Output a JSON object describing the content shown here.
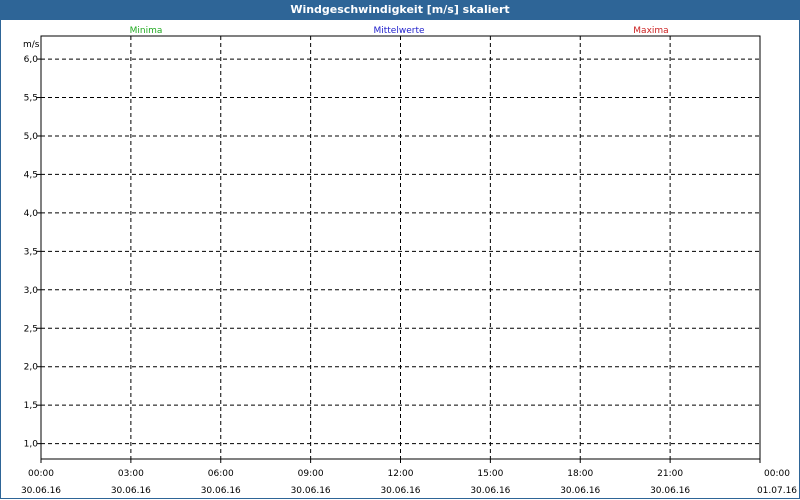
{
  "window": {
    "title": "Windgeschwindigkeit [m/s] skaliert"
  },
  "colors": {
    "titlebar": "#2e6597",
    "minima": "#22aa22",
    "mittelwerte": "#2222cc",
    "maxima": "#cc2222"
  },
  "chart_data": {
    "type": "line",
    "title": "Windgeschwindigkeit [m/s] skaliert",
    "ylabel": "m/s",
    "xlabel": "",
    "ylim": [
      0.8,
      6.3
    ],
    "yticks": [
      "6,0",
      "5,5",
      "5,0",
      "4,5",
      "4,0",
      "3,5",
      "3,0",
      "2,5",
      "2,0",
      "1,5",
      "1,0"
    ],
    "xticks": [
      {
        "time": "00:00",
        "date": "30.06.16"
      },
      {
        "time": "03:00",
        "date": "30.06.16"
      },
      {
        "time": "06:00",
        "date": "30.06.16"
      },
      {
        "time": "09:00",
        "date": "30.06.16"
      },
      {
        "time": "12:00",
        "date": "30.06.16"
      },
      {
        "time": "15:00",
        "date": "30.06.16"
      },
      {
        "time": "18:00",
        "date": "30.06.16"
      },
      {
        "time": "21:00",
        "date": "30.06.16"
      },
      {
        "time": "00:00",
        "date": "01.07.16"
      }
    ],
    "grid": true,
    "legend_placement": "top",
    "series": [
      {
        "name": "Minima",
        "color": "#22aa22",
        "values": []
      },
      {
        "name": "Mittelwerte",
        "color": "#2222cc",
        "values": []
      },
      {
        "name": "Maxima",
        "color": "#cc2222",
        "values": []
      }
    ]
  }
}
